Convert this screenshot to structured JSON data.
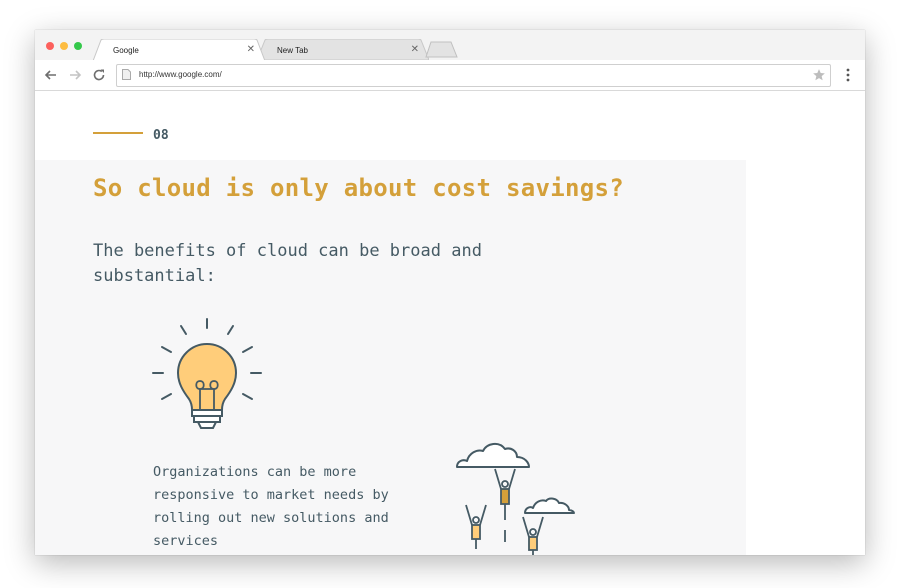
{
  "browser": {
    "tabs": [
      {
        "label": "Google",
        "active": true
      },
      {
        "label": "New Tab",
        "active": false
      }
    ],
    "url": "http://www.google.com/",
    "traffic_colors": {
      "close": "#fc605c",
      "minimize": "#fdbc40",
      "zoom": "#34c84a"
    }
  },
  "page": {
    "section_number": "08",
    "headline": "So cloud is only about cost savings?",
    "intro": "The benefits of cloud can be broad and substantial:",
    "benefit_text": "Organizations can be more responsive to market needs by rolling out new solutions and services",
    "colors": {
      "accent": "#d4a03a",
      "text": "#455a64",
      "panel": "#f7f7f8",
      "bulb_fill": "#ffcd7a"
    },
    "icons": [
      "lightbulb-icon",
      "rising-people-clouds-illustration"
    ]
  }
}
